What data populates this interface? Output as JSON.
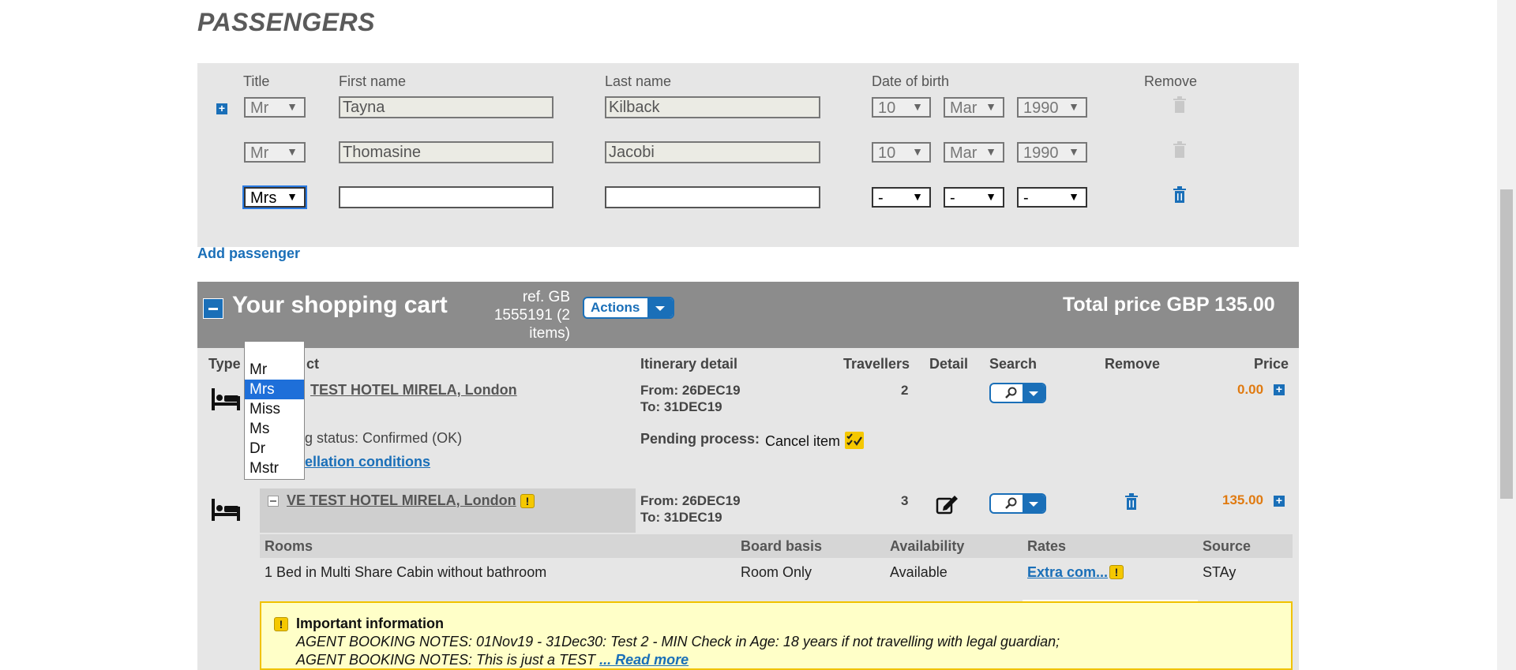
{
  "passengers": {
    "heading": "PASSENGERS",
    "headers": {
      "title": "Title",
      "first_name": "First name",
      "last_name": "Last name",
      "dob": "Date of birth",
      "remove": "Remove"
    },
    "rows": [
      {
        "title": "Mr",
        "first": "Tayna",
        "last": "Kilback",
        "day": "10",
        "month": "Mar",
        "year": "1990"
      },
      {
        "title": "Mr",
        "first": "Thomasine",
        "last": "Jacobi",
        "day": "10",
        "month": "Mar",
        "year": "1990"
      },
      {
        "title": "Mrs",
        "first": "",
        "last": "",
        "day": "-",
        "month": "-",
        "year": "-"
      }
    ],
    "add_label": "Add passenger"
  },
  "title_dropdown": {
    "options": [
      "Mr",
      "Mrs",
      "Miss",
      "Ms",
      "Dr",
      "Mstr"
    ],
    "selected": "Mrs"
  },
  "cart": {
    "title": "Your shopping cart",
    "ref_line1": "ref. GB",
    "ref_line2": "1555191 (2",
    "ref_line3": "items)",
    "actions_label": "Actions",
    "total_label": "Total price GBP 135.00",
    "headers": {
      "type": "Type",
      "product": "ct",
      "itinerary": "Itinerary detail",
      "travellers": "Travellers",
      "detail": "Detail",
      "search": "Search",
      "remove": "Remove",
      "price": "Price"
    },
    "item1": {
      "name": "TEST HOTEL MIRELA, London",
      "from": "From: 26DEC19",
      "to": "To: 31DEC19",
      "travellers": "2",
      "price": "0.00",
      "status": "g status: Confirmed (OK)",
      "pending_label": "Pending process:",
      "pending_value": "Cancel item",
      "cancel_link": "ellation conditions"
    },
    "item2": {
      "name": "VE TEST HOTEL MIRELA, London",
      "from": "From: 26DEC19",
      "to": "To: 31DEC19",
      "travellers": "3",
      "price": "135.00"
    },
    "rooms": {
      "headers": {
        "rooms": "Rooms",
        "board": "Board basis",
        "availability": "Availability",
        "rates": "Rates",
        "source": "Source"
      },
      "row": {
        "room": "1 Bed in Multi Share Cabin without bathroom",
        "board": "Room Only",
        "availability": "Available",
        "rates": "Extra com...",
        "source": "STAy"
      }
    },
    "info": {
      "title": "Important information",
      "line1": "AGENT BOOKING NOTES: 01Nov19 - 31Dec30: Test 2 - MIN Check in Age: 18 years if not travelling with legal guardian;",
      "line2": "AGENT BOOKING NOTES: This is just a TEST",
      "read_more": "... Read more"
    }
  },
  "colors": {
    "accent": "#1a6fb8",
    "price": "#e07a10",
    "cart_header": "#8c8c8c",
    "info_bg": "#ffffc8"
  }
}
